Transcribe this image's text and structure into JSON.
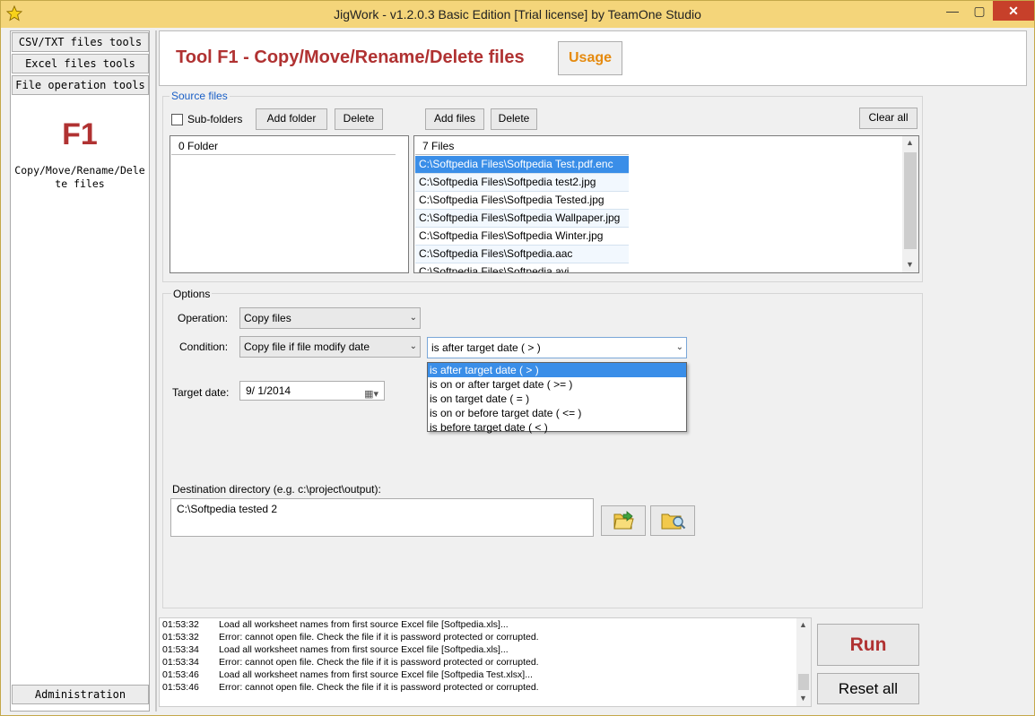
{
  "window": {
    "title": "JigWork - v1.2.0.3 Basic Edition [Trial license] by TeamOne Studio",
    "minimize": "—",
    "maximize": "▢",
    "close": "✕"
  },
  "sidebar": {
    "tabs": [
      "CSV/TXT files tools",
      "Excel files tools",
      "File operation tools"
    ],
    "tool_id": "F1",
    "tool_desc": "Copy/Move/Rename/Delete files",
    "admin": "Administration"
  },
  "header": {
    "title": "Tool F1 - Copy/Move/Rename/Delete files",
    "usage": "Usage"
  },
  "source": {
    "legend": "Source files",
    "subfolders": "Sub-folders",
    "add_folder": "Add folder",
    "delete_folder": "Delete",
    "add_files": "Add files",
    "delete_files": "Delete",
    "clear_all": "Clear all",
    "folder_count": "0 Folder",
    "file_count": "7 Files",
    "files": [
      "C:\\Softpedia Files\\Softpedia Test.pdf.enc",
      "C:\\Softpedia Files\\Softpedia test2.jpg",
      "C:\\Softpedia Files\\Softpedia Tested.jpg",
      "C:\\Softpedia Files\\Softpedia Wallpaper.jpg",
      "C:\\Softpedia Files\\Softpedia Winter.jpg",
      "C:\\Softpedia Files\\Softpedia.aac",
      "C:\\Softpedia Files\\Softpedia.avi"
    ]
  },
  "options": {
    "legend": "Options",
    "operation_label": "Operation:",
    "operation_value": "Copy files",
    "condition_label": "Condition:",
    "condition_value": "Copy file if file modify date",
    "comparison_value": "is after target date ( > )",
    "comparison_options": [
      "is after target date ( > )",
      "is on or after target date ( >= )",
      "is on target date ( = )",
      "is on or before target date ( <= )",
      "is before target date ( < )"
    ],
    "target_date_label": "Target date:",
    "target_date_value": "9/  1/2014",
    "dest_label": "Destination directory (e.g. c:\\project\\output):",
    "dest_value": "C:\\Softpedia tested 2"
  },
  "log": [
    {
      "time": "01:53:32",
      "msg": "Load all worksheet names from first source Excel file [Softpedia.xls]..."
    },
    {
      "time": "01:53:32",
      "msg": "Error: cannot open file. Check the file if it is password protected or corrupted."
    },
    {
      "time": "01:53:34",
      "msg": "Load all worksheet names from first source Excel file [Softpedia.xls]..."
    },
    {
      "time": "01:53:34",
      "msg": "Error: cannot open file. Check the file if it is password protected or corrupted."
    },
    {
      "time": "01:53:46",
      "msg": "Load all worksheet names from first source Excel file [Softpedia Test.xlsx]..."
    },
    {
      "time": "01:53:46",
      "msg": "Error: cannot open file. Check the file if it is password protected or corrupted."
    }
  ],
  "actions": {
    "run": "Run",
    "reset": "Reset all"
  }
}
